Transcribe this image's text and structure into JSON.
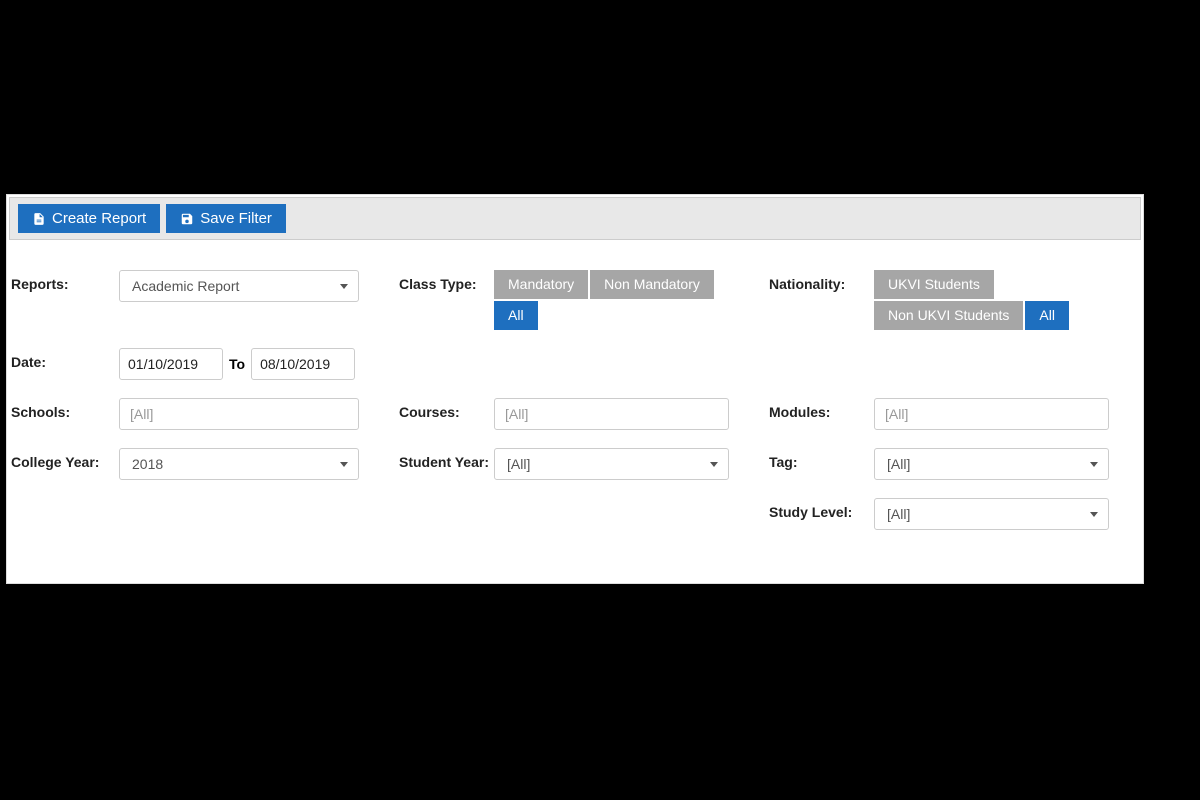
{
  "toolbar": {
    "create_report": "Create Report",
    "save_filter": "Save Filter"
  },
  "labels": {
    "reports": "Reports:",
    "date": "Date:",
    "to": "To",
    "schools": "Schools:",
    "college_year": "College Year:",
    "class_type": "Class Type:",
    "courses": "Courses:",
    "student_year": "Student Year:",
    "nationality": "Nationality:",
    "modules": "Modules:",
    "tag": "Tag:",
    "study_level": "Study Level:"
  },
  "values": {
    "reports_selected": "Academic Report",
    "date_from": "01/10/2019",
    "date_to": "08/10/2019",
    "schools": "[All]",
    "college_year": "2018",
    "courses": "[All]",
    "student_year": "[All]",
    "modules": "[All]",
    "tag": "[All]",
    "study_level": "[All]"
  },
  "class_type": {
    "options": [
      "Mandatory",
      "Non Mandatory",
      "All"
    ],
    "active": "All"
  },
  "nationality": {
    "options": [
      "UKVI Students",
      "Non UKVI Students",
      "All"
    ],
    "active": "All"
  }
}
